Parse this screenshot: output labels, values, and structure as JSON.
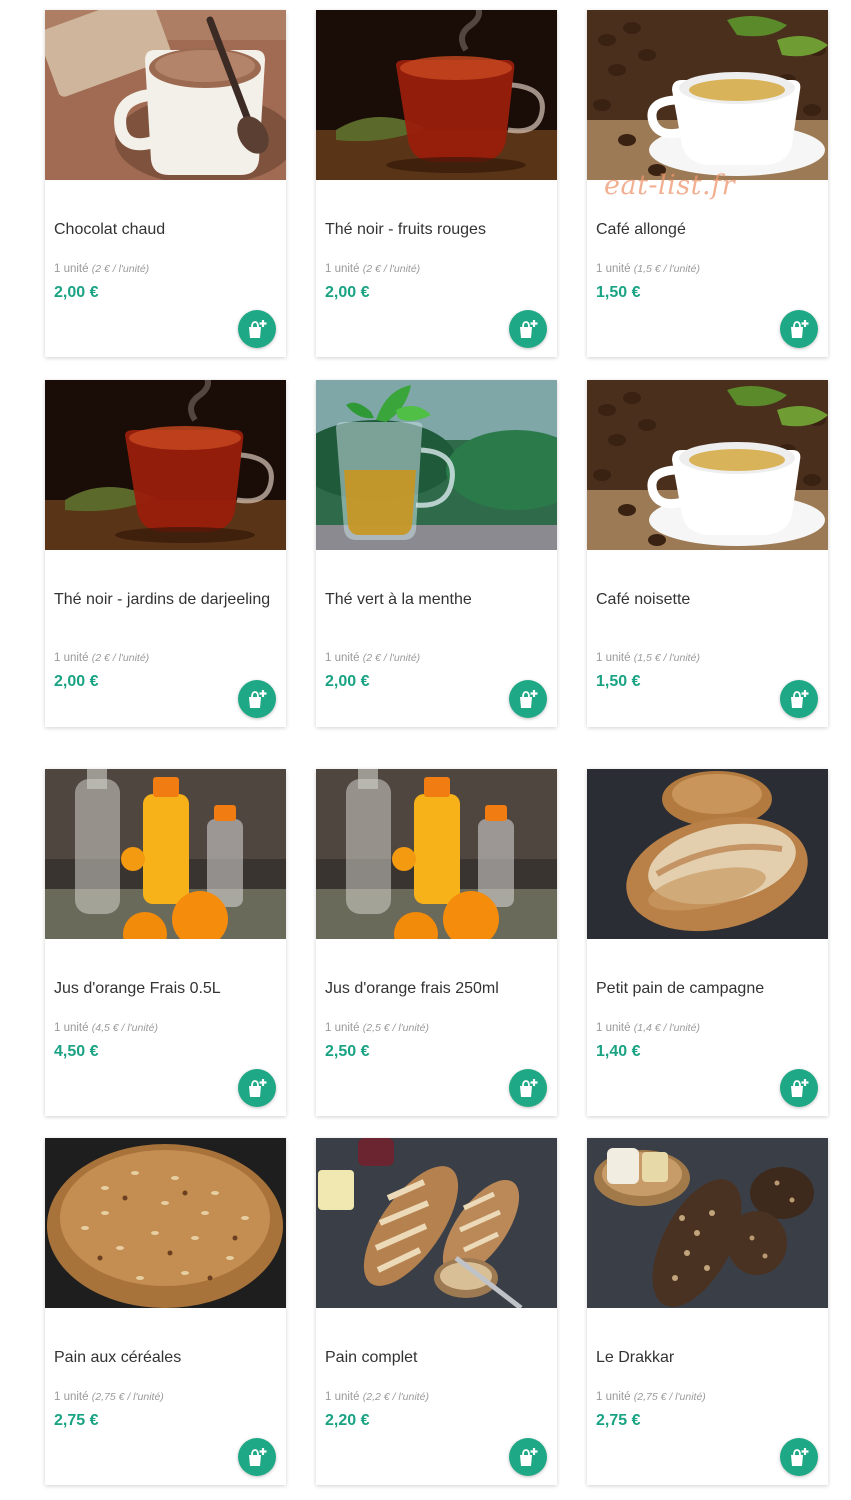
{
  "watermark": "eat-list.fr",
  "colors": {
    "accent": "#1fa886",
    "price": "#1aa383",
    "text": "#333333",
    "muted": "#9a9a9a"
  },
  "products": [
    {
      "name": "Chocolat chaud",
      "unit": "1 unité",
      "unit_price": "(2 € / l'unité)",
      "price": "2,00 €",
      "photo": "hot-chocolate-photo"
    },
    {
      "name": "Thé noir - fruits rouges",
      "unit": "1 unité",
      "unit_price": "(2 € / l'unité)",
      "price": "2,00 €",
      "photo": "black-tea-photo"
    },
    {
      "name": "Café allongé",
      "unit": "1 unité",
      "unit_price": "(1,5 € / l'unité)",
      "price": "1,50 €",
      "photo": "coffee-cup-photo"
    },
    {
      "name": "Thé noir - jardins de darjeeling",
      "unit": "1 unité",
      "unit_price": "(2 € / l'unité)",
      "price": "2,00 €",
      "photo": "black-tea-photo"
    },
    {
      "name": "Thé vert à la menthe",
      "unit": "1 unité",
      "unit_price": "(2 € / l'unité)",
      "price": "2,00 €",
      "photo": "mint-tea-photo"
    },
    {
      "name": "Café noisette",
      "unit": "1 unité",
      "unit_price": "(1,5 € / l'unité)",
      "price": "1,50 €",
      "photo": "coffee-cup-photo"
    },
    {
      "name": "Jus d'orange Frais 0.5L",
      "unit": "1 unité",
      "unit_price": "(4,5 € / l'unité)",
      "price": "4,50 €",
      "photo": "orange-juice-photo"
    },
    {
      "name": "Jus d'orange frais 250ml",
      "unit": "1 unité",
      "unit_price": "(2,5 € / l'unité)",
      "price": "2,50 €",
      "photo": "orange-juice-photo"
    },
    {
      "name": "Petit pain de campagne",
      "unit": "1 unité",
      "unit_price": "(1,4 € / l'unité)",
      "price": "1,40 €",
      "photo": "country-bread-photo"
    },
    {
      "name": "Pain aux céréales",
      "unit": "1 unité",
      "unit_price": "(2,75 € / l'unité)",
      "price": "2,75 €",
      "photo": "cereal-bread-photo"
    },
    {
      "name": "Pain complet",
      "unit": "1 unité",
      "unit_price": "(2,2 € / l'unité)",
      "price": "2,20 €",
      "photo": "wholemeal-bread-photo"
    },
    {
      "name": "Le Drakkar",
      "unit": "1 unité",
      "unit_price": "(2,75 € / l'unité)",
      "price": "2,75 €",
      "photo": "drakkar-bread-photo"
    }
  ]
}
